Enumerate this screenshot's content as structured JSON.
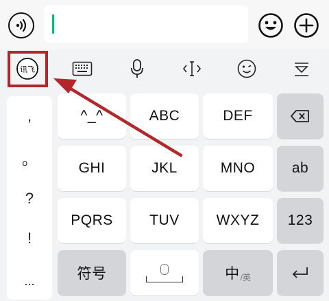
{
  "chat_input": {
    "voice_icon": "voice-icon",
    "emoji_icon": "emoji-icon",
    "plus_icon": "plus-icon"
  },
  "toolbar": {
    "items": [
      {
        "name": "ime-logo",
        "label": "讯飞"
      },
      {
        "name": "keyboard-icon"
      },
      {
        "name": "microphone-icon"
      },
      {
        "name": "cursor-icon"
      },
      {
        "name": "emoticon-icon"
      },
      {
        "name": "collapse-icon"
      }
    ],
    "highlight_color": "#b5262a"
  },
  "keyboard": {
    "punctuation": [
      ",",
      "。",
      "?",
      "!",
      "..."
    ],
    "row1": [
      "^_^",
      "ABC",
      "DEF"
    ],
    "row2": [
      "GHI",
      "JKL",
      "MNO",
      "ab"
    ],
    "row3": [
      "PQRS",
      "TUV",
      "WXYZ",
      "123"
    ],
    "symbols_label": "符号",
    "cn_label": "中",
    "en_sub": "/英",
    "enter_icon": "enter-icon",
    "backspace_icon": "backspace-icon"
  }
}
